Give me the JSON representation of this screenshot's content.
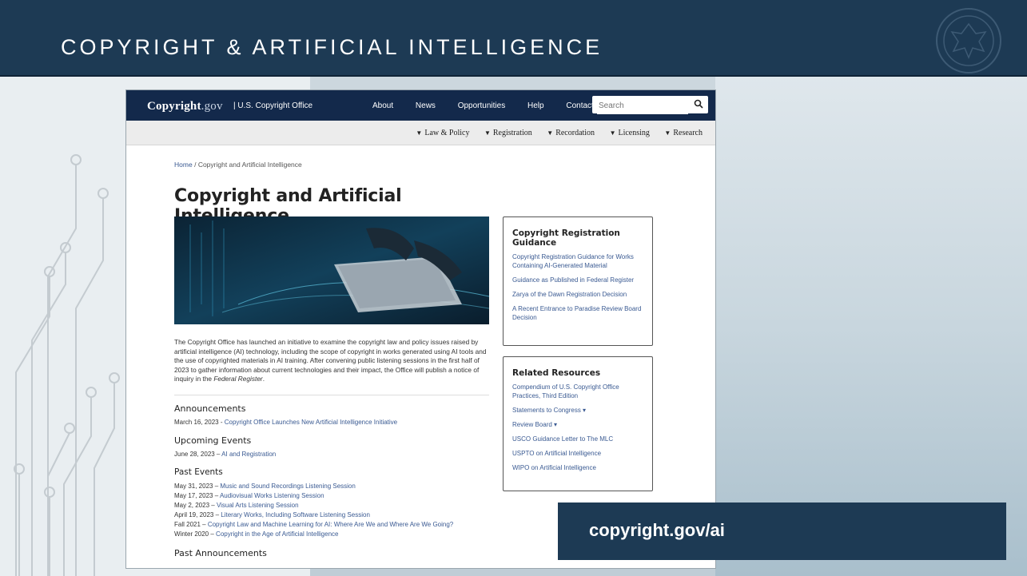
{
  "slide": {
    "title": "COPYRIGHT & ARTIFICIAL INTELLIGENCE",
    "callout": "copyright.gov/ai"
  },
  "site": {
    "logo_main": "Copyright",
    "logo_gov": ".gov",
    "logo_sub": "| U.S. Copyright Office",
    "topnav": [
      "About",
      "News",
      "Opportunities",
      "Help",
      "Contact"
    ],
    "search_placeholder": "Search",
    "subnav": [
      "Law & Policy",
      "Registration",
      "Recordation",
      "Licensing",
      "Research"
    ],
    "breadcrumb": {
      "home": "Home",
      "sep": "/",
      "current": "Copyright and Artificial Intelligence"
    },
    "page_title": "Copyright and Artificial Intelligence",
    "intro": "The Copyright Office has launched an initiative to examine the copyright law and policy issues raised by artificial intelligence (AI) technology, including the scope of copyright in works generated using AI tools and the use of copyrighted materials in AI training. After convening public listening sessions in the first half of 2023 to gather information about current technologies and their impact, the Office will publish a notice of inquiry in the ",
    "intro_italic": "Federal Register",
    "intro_end": ".",
    "announcements": {
      "heading": "Announcements",
      "items": [
        {
          "date": "March 16, 2023 -",
          "link": "Copyright Office Launches New Artificial Intelligence Initiative"
        }
      ]
    },
    "upcoming": {
      "heading": "Upcoming Events",
      "items": [
        {
          "date": "June 28, 2023 –",
          "link": "AI and Registration"
        }
      ]
    },
    "past": {
      "heading": "Past Events",
      "items": [
        {
          "date": "May 31, 2023 –",
          "link": "Music and Sound Recordings Listening Session"
        },
        {
          "date": "May 17, 2023 –",
          "link": "Audiovisual Works Listening Session"
        },
        {
          "date": "May 2, 2023 –",
          "link": "Visual Arts Listening Session"
        },
        {
          "date": "April 19, 2023 –",
          "link": "Literary Works, Including Software Listening Session"
        },
        {
          "date": "Fall 2021 –",
          "link": "Copyright Law and Machine Learning for AI: Where Are We and Where Are We Going?"
        },
        {
          "date": "Winter 2020 –",
          "link": "Copyright in the Age of Artificial Intelligence"
        }
      ]
    },
    "past_announcements": {
      "heading": "Past Announcements"
    },
    "sidebar_registration": {
      "heading": "Copyright Registration Guidance",
      "links": [
        "Copyright Registration Guidance for Works Containing AI-Generated Material",
        "Guidance as Published in Federal Register",
        "Zarya of the Dawn Registration Decision",
        "A Recent Entrance to Paradise Review Board Decision"
      ]
    },
    "sidebar_resources": {
      "heading": "Related Resources",
      "links": [
        "Compendium of U.S. Copyright Office Practices, Third Edition",
        "Statements to Congress ▾",
        "Review Board ▾",
        "USCO Guidance Letter to The MLC",
        "USPTO on Artificial Intelligence",
        "WIPO on Artificial Intelligence"
      ]
    }
  }
}
